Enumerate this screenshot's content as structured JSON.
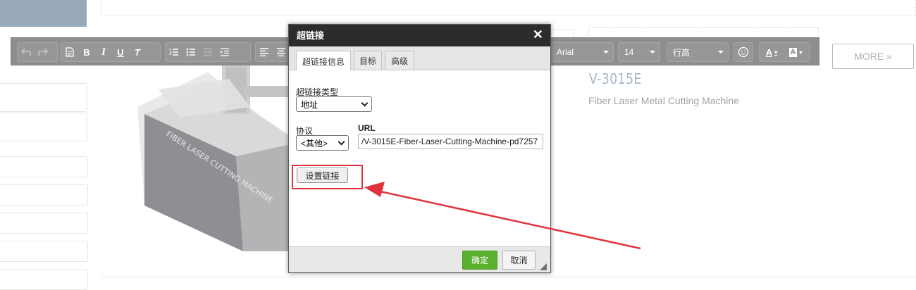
{
  "toolbar": {
    "font_name": "Arial",
    "font_size": "14",
    "line_height": "行高",
    "buttons": [
      "undo",
      "redo",
      "document",
      "bold",
      "italic",
      "underline",
      "clear-format",
      "ordered-list",
      "bullet-list",
      "outdent",
      "indent",
      "align-left",
      "align-center"
    ],
    "bold_label": "B",
    "italic_label": "I",
    "underline_label": "U",
    "clear_label": "T",
    "text_color_label": "A",
    "bg_color_label": "A"
  },
  "product": {
    "title": "V-3015E",
    "subtitle": "Fiber Laser Metal Cutting Machine",
    "more_label": "MORE »",
    "machine_side_text": "FIBER LASER CUTTING MACHINE"
  },
  "dialog": {
    "title": "超链接",
    "close_label": "✕",
    "tabs": [
      {
        "label": "超链接信息",
        "active": true
      },
      {
        "label": "目标",
        "active": false
      },
      {
        "label": "高级",
        "active": false
      }
    ],
    "link_type_label": "超链接类型",
    "link_type_value": "地址",
    "protocol_label": "协议",
    "protocol_value": "<其他>",
    "url_label": "URL",
    "url_value": "/V-3015E-Fiber-Laser-Cutting-Machine-pd7257",
    "set_link_label": "设置链接",
    "ok_label": "确定",
    "cancel_label": "取消"
  },
  "colors": {
    "annotation_red": "#e0333b",
    "ok_green": "#5bb02f",
    "toolbar_gray": "#8e8e8e",
    "title_blue_gray": "#a7b6c3"
  }
}
